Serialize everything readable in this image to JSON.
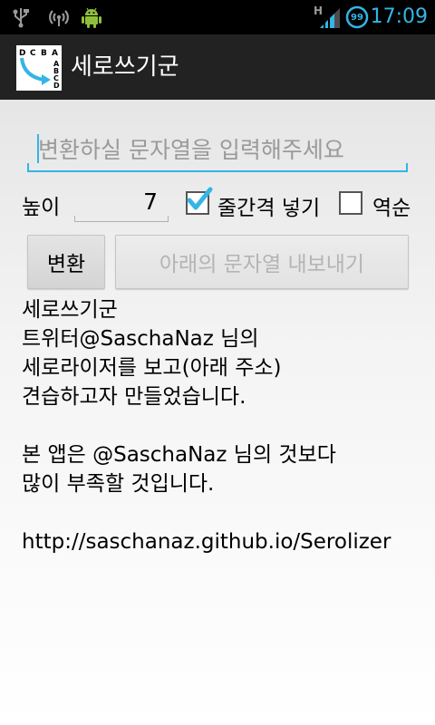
{
  "status_bar": {
    "time": "17:09",
    "battery_level": "99",
    "network_type": "H",
    "icons": [
      "usb-icon",
      "wifi-signal-icon",
      "android-debug-icon",
      "network-h-icon",
      "signal-bars-icon",
      "battery-icon"
    ]
  },
  "action_bar": {
    "title": "세로쓰기군",
    "icon_letters_top": [
      "D",
      "C",
      "B",
      "A"
    ],
    "icon_letters_side": [
      "A",
      "B",
      "C",
      "D"
    ]
  },
  "input": {
    "placeholder": "변환하실 문자열을 입력해주세요",
    "value": ""
  },
  "options": {
    "height_label": "높이",
    "height_value": "7",
    "line_spacing_label": "줄간격 넣기",
    "line_spacing_checked": true,
    "reverse_label": "역순",
    "reverse_checked": false
  },
  "buttons": {
    "convert": "변환",
    "export": "아래의 문자열 내보내기"
  },
  "output_lines": [
    "세로쓰기군",
    "트위터@SaschaNaz 님의",
    "세로라이저를 보고(아래 주소)",
    "견습하고자 만들었습니다.",
    "",
    "본 앱은 @SaschaNaz 님의 것보다",
    "많이 부족할 것입니다.",
    "",
    "http://saschanaz.github.io/Serolizer"
  ],
  "colors": {
    "accent": "#33b5e5",
    "status_bar": "#000000",
    "action_bar": "#222222"
  }
}
